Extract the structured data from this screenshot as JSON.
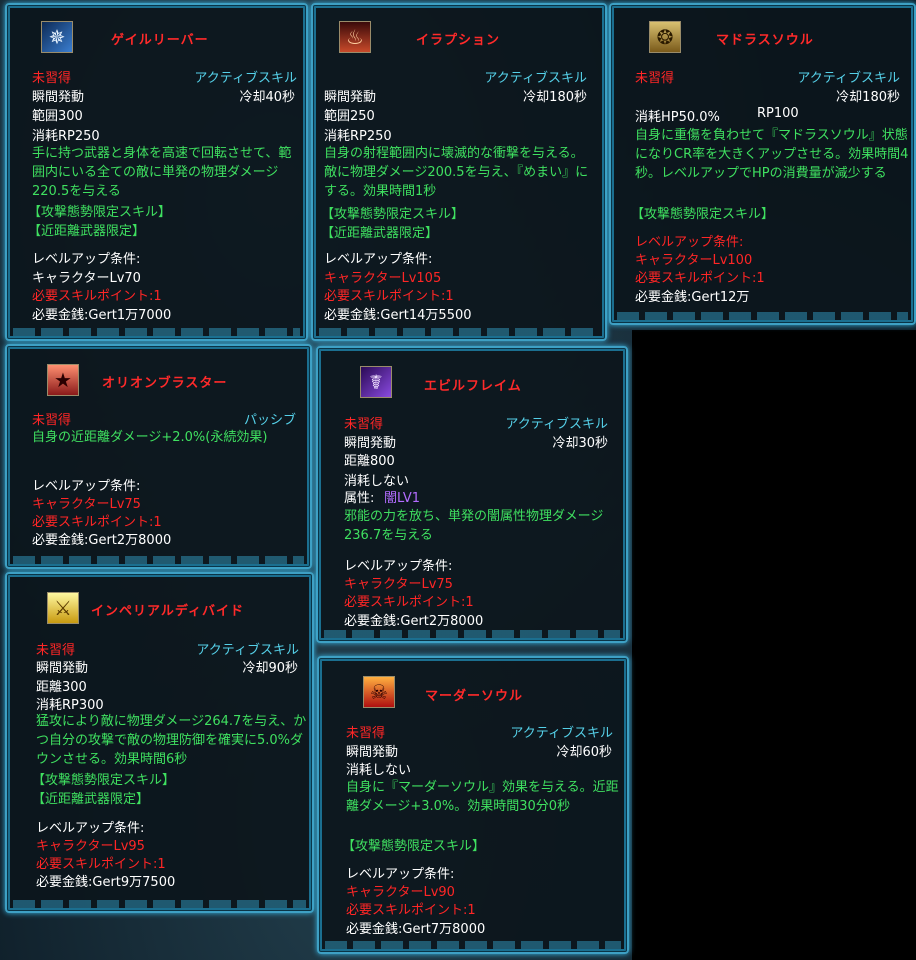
{
  "tooltips": [
    {
      "id": "gale-reaper",
      "icon": "gale-reaper-icon",
      "title": "ゲイルリーバー",
      "status": "未習得",
      "type": "アクティブスキル",
      "cast": "瞬間発動",
      "cooldown": "冷却40秒",
      "range": "範囲300",
      "cost": "消耗RP250",
      "desc": "手に持つ武器と身体を高速で回転させて、範囲内にいる全ての敵に単発の物理ダメージ220.5を与える",
      "tags": [
        "【攻撃態勢限定スキル】",
        "【近距離武器限定】"
      ],
      "levelup_label": "レベルアップ条件:",
      "req_char": "キャラクターLv70",
      "req_points": "必要スキルポイント:1",
      "req_gold": "必要金銭:Gert1万7000"
    },
    {
      "id": "eruption",
      "icon": "eruption-icon",
      "title": "イラプション",
      "type": "アクティブスキル",
      "cast": "瞬間発動",
      "cooldown": "冷却180秒",
      "range": "範囲250",
      "cost": "消耗RP250",
      "desc": "自身の射程範囲内に壊滅的な衝撃を与える。敵に物理ダメージ200.5を与え、『めまい』にする。効果時間1秒",
      "tags": [
        "【攻撃態勢限定スキル】",
        "【近距離武器限定】"
      ],
      "levelup_label": "レベルアップ条件:",
      "req_char": "キャラクターLv105",
      "req_points": "必要スキルポイント:1",
      "req_gold": "必要金銭:Gert14万5500"
    },
    {
      "id": "madras-soul",
      "icon": "madras-soul-icon",
      "title": "マドラスソウル",
      "status": "未習得",
      "type": "アクティブスキル",
      "cooldown": "冷却180秒",
      "cost_hp": "消耗HP50.0%",
      "cost_rp": "RP100",
      "desc": "自身に重傷を負わせて『マドラスソウル』状態になりCR率を大きくアップさせる。効果時間4秒。レベルアップでHPの消費量が減少する",
      "tags": [
        "【攻撃態勢限定スキル】"
      ],
      "levelup_label": "レベルアップ条件:",
      "req_char": "キャラクターLv100",
      "req_points": "必要スキルポイント:1",
      "req_gold": "必要金銭:Gert12万"
    },
    {
      "id": "orion-blaster",
      "icon": "orion-blaster-icon",
      "title": "オリオンブラスター",
      "status": "未習得",
      "type": "パッシブ",
      "desc": "自身の近距離ダメージ+2.0%(永続効果)",
      "levelup_label": "レベルアップ条件:",
      "req_char": "キャラクターLv75",
      "req_points": "必要スキルポイント:1",
      "req_gold": "必要金銭:Gert2万8000"
    },
    {
      "id": "evil-flame",
      "icon": "evil-flame-icon",
      "title": "エビルフレイム",
      "status": "未習得",
      "type": "アクティブスキル",
      "cast": "瞬間発動",
      "cooldown": "冷却30秒",
      "range": "距離800",
      "cost": "消耗しない",
      "attr_label": "属性:",
      "attr_value": "闇LV1",
      "desc": "邪能の力を放ち、単発の闇属性物理ダメージ236.7を与える",
      "levelup_label": "レベルアップ条件:",
      "req_char": "キャラクターLv75",
      "req_points": "必要スキルポイント:1",
      "req_gold": "必要金銭:Gert2万8000"
    },
    {
      "id": "imperial-divide",
      "icon": "imperial-divide-icon",
      "title": "インペリアルディバイド",
      "status": "未習得",
      "type": "アクティブスキル",
      "cast": "瞬間発動",
      "cooldown": "冷却90秒",
      "range": "距離300",
      "cost": "消耗RP300",
      "desc": "猛攻により敵に物理ダメージ264.7を与え、かつ自分の攻撃で敵の物理防御を確実に5.0%ダウンさせる。効果時間6秒",
      "tags": [
        "【攻撃態勢限定スキル】",
        "【近距離武器限定】"
      ],
      "levelup_label": "レベルアップ条件:",
      "req_char": "キャラクターLv95",
      "req_points": "必要スキルポイント:1",
      "req_gold": "必要金銭:Gert9万7500"
    },
    {
      "id": "murder-soul",
      "icon": "murder-soul-icon",
      "title": "マーダーソウル",
      "status": "未習得",
      "type": "アクティブスキル",
      "cast": "瞬間発動",
      "cooldown": "冷却60秒",
      "cost": "消耗しない",
      "desc": "自身に『マーダーソウル』効果を与える。近距離ダメージ+3.0%。効果時間30分0秒",
      "tags": [
        "【攻撃態勢限定スキル】"
      ],
      "levelup_label": "レベルアップ条件:",
      "req_char": "キャラクターLv90",
      "req_points": "必要スキルポイント:1",
      "req_gold": "必要金銭:Gert7万8000"
    }
  ]
}
